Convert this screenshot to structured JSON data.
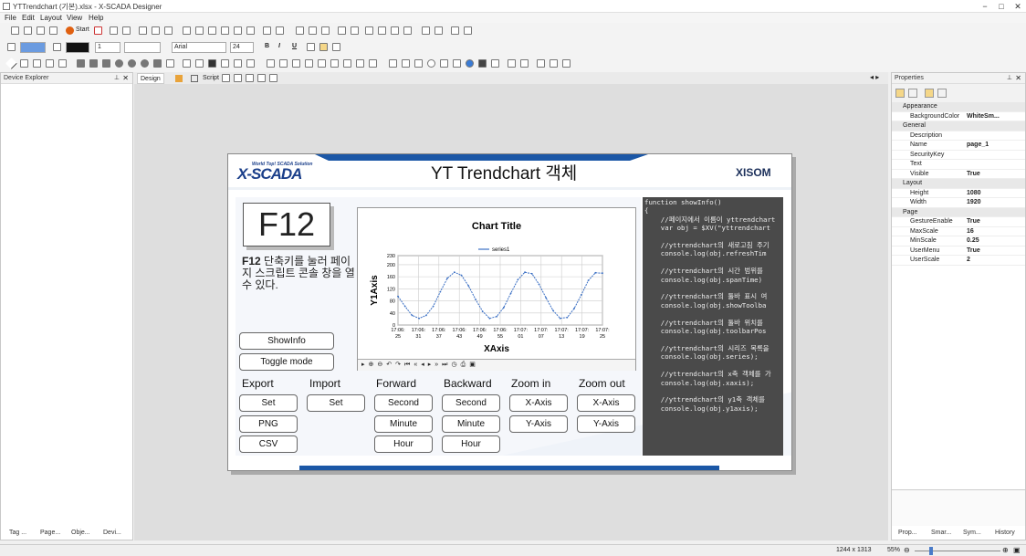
{
  "app": {
    "title": "YTTrendchart (기본).xlsx - X-SCADA Designer",
    "menus": [
      "File",
      "Edit",
      "Layout",
      "View",
      "Help"
    ]
  },
  "toolbar": {
    "start": "Start",
    "font": "Arial",
    "font_size": "24",
    "line_width": "1",
    "bold": "B",
    "italic": "I",
    "underline": "U"
  },
  "left_panel": {
    "title": "Device Explorer",
    "tabs": [
      "Tag ...",
      "Page...",
      "Obje...",
      "Devi..."
    ]
  },
  "doc_tabs": {
    "design": "Design",
    "script": "Script"
  },
  "page": {
    "logo_small": "World Top! SCADA Solution",
    "logo": "X-SCADA",
    "title": "YT Trendchart 객체",
    "brand": "XISOM",
    "key": "F12",
    "key_desc_bold": "F12",
    "key_desc": "단축키를 눌러 페이지 스크립트 콘솔 창을 열 수 있다.",
    "show_info": "ShowInfo",
    "toggle_mode": "Toggle mode",
    "sections": {
      "export": "Export",
      "import": "Import",
      "forward": "Forward",
      "backward": "Backward",
      "zoom_in": "Zoom in",
      "zoom_out": "Zoom out"
    },
    "buttons": {
      "set": "Set",
      "png": "PNG",
      "csv": "CSV",
      "second": "Second",
      "minute": "Minute",
      "hour": "Hour",
      "x_axis": "X-Axis",
      "y_axis": "Y-Axis"
    },
    "code": "function showInfo()\n{\n    //페이지에서 이름이 yttrendchart\n    var obj = $XV(\"yttrendchart\n\n    //yttrendchart의 새로고침 주기\n    console.log(obj.refreshTim\n\n    //yttrendchart의 시간 범위를\n    console.log(obj.spanTime)\n\n    //yttrendchart의 툴바 표시 여\n    console.log(obj.showToolba\n\n    //yttrendchart의 툴바 위치를\n    console.log(obj.toolbarPos\n\n    //yttrendchart의 시리즈 목록을\n    console.log(obj.series);\n\n    //yttrendchart의 x축 객체를 가\n    console.log(obj.xaxis);\n\n    //yttrendchart의 y1축 객체를\n    console.log(obj.y1axis);"
  },
  "chart_data": {
    "type": "line",
    "title": "Chart Title",
    "xlabel": "XAxis",
    "ylabel": "Y1Axis",
    "series": [
      {
        "name": "series1",
        "color": "#3a6fc4"
      }
    ],
    "yticks": [
      "0",
      "40",
      "80",
      "120",
      "160",
      "200",
      "230"
    ],
    "ylim": [
      0,
      230
    ],
    "xticks": [
      [
        "17:06:",
        "25"
      ],
      [
        "17:06:",
        "31"
      ],
      [
        "17:06:",
        "37"
      ],
      [
        "17:06:",
        "43"
      ],
      [
        "17:06:",
        "49"
      ],
      [
        "17:06:",
        "55"
      ],
      [
        "17:07:",
        "01"
      ],
      [
        "17:07:",
        "07"
      ],
      [
        "17:07:",
        "13"
      ],
      [
        "17:07:",
        "19"
      ],
      [
        "17:07:",
        "25"
      ]
    ],
    "values": [
      95,
      62,
      32,
      22,
      32,
      62,
      110,
      155,
      175,
      165,
      130,
      85,
      45,
      22,
      28,
      58,
      105,
      150,
      175,
      170,
      135,
      90,
      48,
      22,
      25,
      55,
      100,
      148,
      173,
      172
    ]
  },
  "properties": {
    "title": "Properties",
    "rows": [
      {
        "cat": "Appearance"
      },
      {
        "k": "BackgroundColor",
        "v": "WhiteSm..."
      },
      {
        "cat": "General"
      },
      {
        "k": "Description",
        "v": ""
      },
      {
        "k": "Name",
        "v": "page_1"
      },
      {
        "k": "SecurityKey",
        "v": ""
      },
      {
        "k": "Text",
        "v": ""
      },
      {
        "k": "Visible",
        "v": "True"
      },
      {
        "cat": "Layout"
      },
      {
        "k": "Height",
        "v": "1080"
      },
      {
        "k": "Width",
        "v": "1920"
      },
      {
        "cat": "Page"
      },
      {
        "k": "GestureEnable",
        "v": "True"
      },
      {
        "k": "MaxScale",
        "v": "16"
      },
      {
        "k": "MinScale",
        "v": "0.25"
      },
      {
        "k": "UserMenu",
        "v": "True"
      },
      {
        "k": "UserScale",
        "v": "2"
      }
    ],
    "tabs": [
      "Prop...",
      "Smar...",
      "Sym...",
      "History"
    ]
  },
  "status": {
    "size": "1244 x 1313",
    "zoom": "55%"
  }
}
